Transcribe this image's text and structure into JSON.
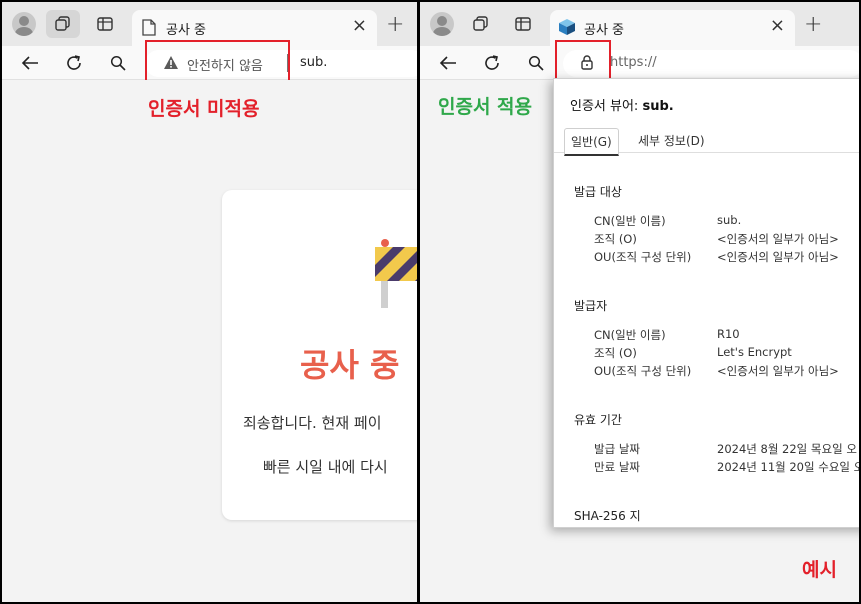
{
  "left": {
    "tab_title": "공사 중",
    "address_warning": "안전하지 않음",
    "address_url": "sub.",
    "caption": "인증서 미적용",
    "card": {
      "title": "공사 중",
      "line1": "죄송합니다. 현재 페이",
      "line2": "빠른 시일 내에 다시"
    }
  },
  "right": {
    "tab_title": "공사 중",
    "address_url": "https://",
    "caption": "인증서 적용",
    "dialog": {
      "title_prefix": "인증서 뷰어: ",
      "title_domain": "sub.",
      "tabs": [
        "일반(G)",
        "세부 정보(D)"
      ],
      "issued_to": {
        "heading": "발급 대상",
        "fields": [
          {
            "label": "CN(일반 이름)",
            "value": "sub."
          },
          {
            "label": "조직 (O)",
            "value": "<인증서의 일부가 아님>"
          },
          {
            "label": "OU(조직 구성 단위)",
            "value": "<인증서의 일부가 아님>"
          }
        ]
      },
      "issuer": {
        "heading": "발급자",
        "fields": [
          {
            "label": "CN(일반 이름)",
            "value": "R10"
          },
          {
            "label": "조직 (O)",
            "value": "Let's Encrypt"
          },
          {
            "label": "OU(조직 구성 단위)",
            "value": "<인증서의 일부가 아님>"
          }
        ]
      },
      "validity": {
        "heading": "유효 기간",
        "fields": [
          {
            "label": "발급 날짜",
            "value": "2024년 8월 22일 목요일 오"
          },
          {
            "label": "만료 날짜",
            "value": "2024년 11월 20일 수요일 오"
          }
        ]
      },
      "sha_heading": "SHA-256 지"
    },
    "example_label": "예시"
  },
  "colors": {
    "red_caption": "#e3202a",
    "green_caption": "#2fa84a",
    "title_orange": "#e8604c"
  }
}
